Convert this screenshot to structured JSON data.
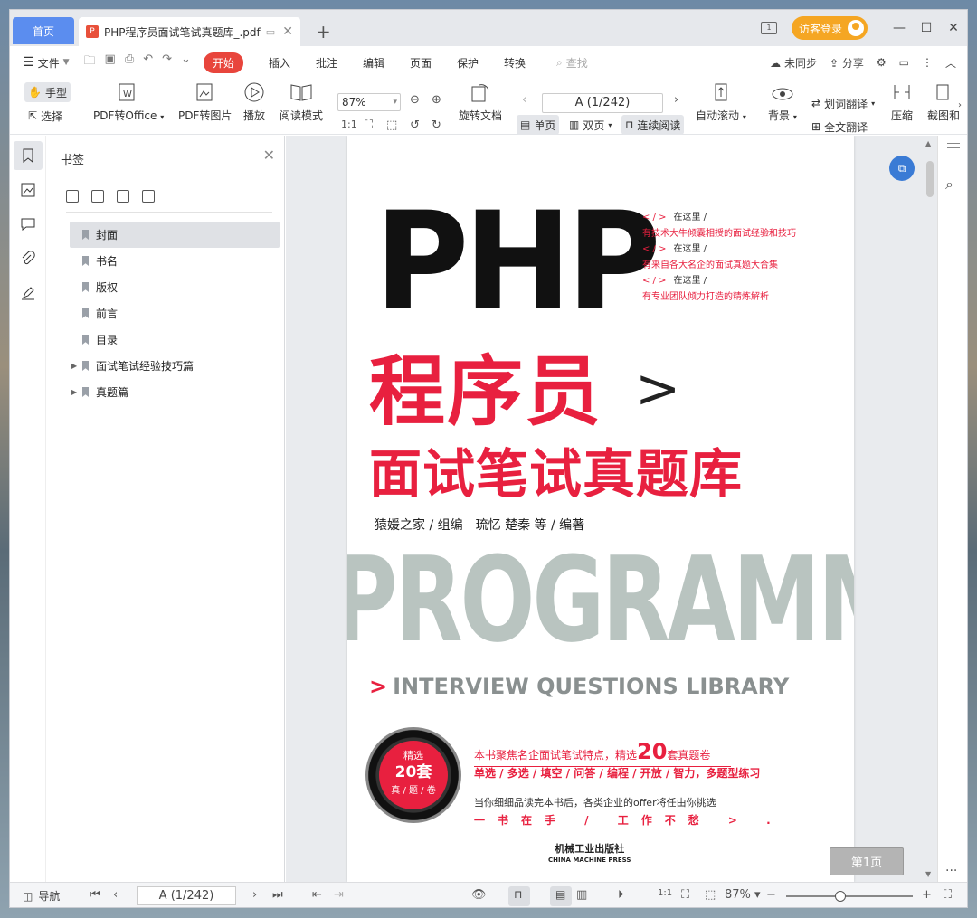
{
  "titlebar": {
    "home_tab": "首页",
    "doc_tab": "PHP程序员面试笔试真题库_.pdf",
    "pdf_badge": "P",
    "login": "访客登录"
  },
  "menubar": {
    "file": "文件",
    "start": "开始",
    "items": [
      "插入",
      "批注",
      "编辑",
      "页面",
      "保护",
      "转换"
    ],
    "find": "查找",
    "sync": "未同步",
    "share": "分享"
  },
  "toolbar": {
    "hand": "手型",
    "select": "选择",
    "pdf_to_office": "PDF转Office",
    "pdf_to_image": "PDF转图片",
    "play": "播放",
    "read_mode": "阅读模式",
    "zoom": "87%",
    "rotate": "旋转文档",
    "page_indicator": "A (1/242)",
    "single": "单页",
    "double": "双页",
    "continuous": "连续阅读",
    "auto_scroll": "自动滚动",
    "background": "背景",
    "word_translate": "划词翻译",
    "full_translate": "全文翻译",
    "compress": "压缩",
    "screenshot": "截图和"
  },
  "bookmarks": {
    "title": "书签",
    "items": [
      {
        "label": "封面",
        "selected": true,
        "expandable": false
      },
      {
        "label": "书名",
        "selected": false,
        "expandable": false
      },
      {
        "label": "版权",
        "selected": false,
        "expandable": false
      },
      {
        "label": "前言",
        "selected": false,
        "expandable": false
      },
      {
        "label": "目录",
        "selected": false,
        "expandable": false
      },
      {
        "label": "面试笔试经验技巧篇",
        "selected": false,
        "expandable": true
      },
      {
        "label": "真题篇",
        "selected": false,
        "expandable": true
      }
    ]
  },
  "cover": {
    "php": "PHP",
    "taglines": [
      {
        "marker": "< / >",
        "head": "在这里 /",
        "text": "有技术大牛倾囊相授的面试经验和技巧"
      },
      {
        "marker": "< / >",
        "head": "在这里 /",
        "text": "有来自各大名企的面试真题大合集"
      },
      {
        "marker": "< / >",
        "head": "在这里 /",
        "text": "有专业团队倾力打造的精炼解析"
      }
    ],
    "title1": "程序员",
    "arrow": ">",
    "title2": "面试笔试真题库",
    "authors": "猿媛之家 / 组编　琉忆 楚秦 等 / 编著",
    "programmer": "PROGRAMMER",
    "iql_arrow": ">",
    "iql": "INTERVIEW QUESTIONS LIBRARY",
    "seal_top": "精选",
    "seal_mid": "20套",
    "seal_bot": "真 / 题 / 卷",
    "feat1_pre": "本书聚焦名企面试笔试特点，精选",
    "feat1_num": "20",
    "feat1_post": "套真题卷",
    "feat2": "单选 / 多选 / 填空 / 问答 / 编程 / 开放 / 智力，多题型练习",
    "feat3": "当你细细品读完本书后，各类企业的offer将任由你挑选",
    "feat4": "一书在手 / 工作不愁 > .",
    "publisher_cn": "机械工业出版社",
    "publisher_en": "CHINA MACHINE PRESS"
  },
  "page_badge": "第1页",
  "statusbar": {
    "nav": "导航",
    "page": "A (1/242)",
    "zoom": "87%"
  }
}
